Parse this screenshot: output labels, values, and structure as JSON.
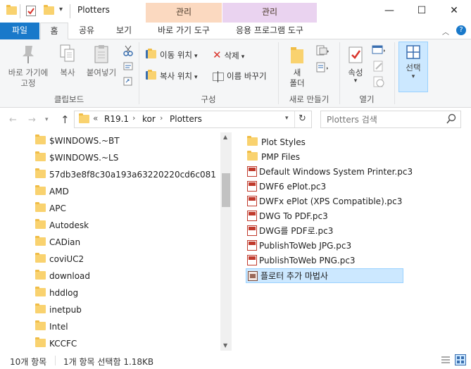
{
  "window": {
    "title": "Plotters",
    "context_tab_1": "관리",
    "context_tab_2": "관리",
    "minimize": "—",
    "maximize": "☐",
    "close": "✕"
  },
  "ribbon_tabs": {
    "file": "파일",
    "home": "홈",
    "share": "공유",
    "view": "보기",
    "shortcut_tools": "바로 가기 도구",
    "app_tools": "응용 프로그램 도구"
  },
  "ribbon": {
    "pin_quick_access": "바로 가기에\n고정",
    "copy": "복사",
    "paste": "붙여넣기",
    "clipboard_group": "클립보드",
    "move_to": "이동 위치",
    "copy_to": "복사 위치",
    "delete": "삭제",
    "rename": "이름 바꾸기",
    "organize_group": "구성",
    "new_folder": "새\n폴더",
    "new_group": "새로 만들기",
    "properties": "속성",
    "open_group": "열기",
    "select": "선택"
  },
  "address": {
    "path_prefix": "«",
    "crumbs": [
      "R19.1",
      "kor",
      "Plotters"
    ],
    "search_placeholder": "Plotters 검색"
  },
  "tree": {
    "items": [
      "$WINDOWS.~BT",
      "$WINDOWS.~LS",
      "57db3e8f8c30a193a63220220cd6c081",
      "AMD",
      "APC",
      "Autodesk",
      "CADian",
      "coviUC2",
      "download",
      "hddlog",
      "inetpub",
      "Intel",
      "KCCFC"
    ]
  },
  "files": {
    "folders": [
      "Plot Styles",
      "PMP Files"
    ],
    "pc3": [
      "Default Windows System Printer.pc3",
      "DWF6 ePlot.pc3",
      "DWFx ePlot (XPS Compatible).pc3",
      "DWG To PDF.pc3",
      "DWG를 PDF로.pc3",
      "PublishToWeb JPG.pc3",
      "PublishToWeb PNG.pc3"
    ],
    "wizard": "플로터 추가 마법사"
  },
  "status": {
    "item_count": "10개 항목",
    "selection": "1개 항목 선택함 1.18KB"
  },
  "colors": {
    "file_tab": "#1979ca",
    "context1": "#fbd9c0",
    "context2": "#ead3f0",
    "selection": "#cce8ff"
  }
}
